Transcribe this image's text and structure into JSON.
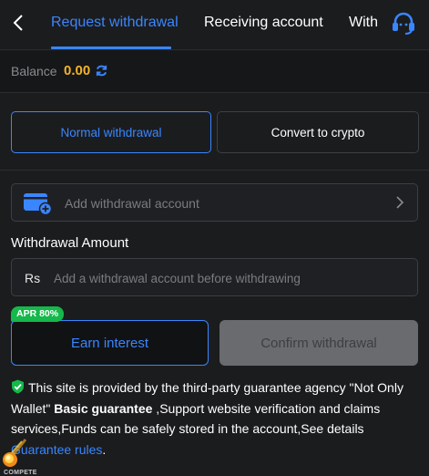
{
  "header": {
    "tabs": [
      {
        "label": "Request withdrawal",
        "active": true
      },
      {
        "label": "Receiving account",
        "active": false
      },
      {
        "label": "With",
        "active": false
      }
    ]
  },
  "balance": {
    "label": "Balance",
    "value": "0.00"
  },
  "withdraw_modes": {
    "normal": "Normal withdrawal",
    "crypto": "Convert to crypto"
  },
  "account": {
    "placeholder": "Add withdrawal account"
  },
  "amount": {
    "label": "Withdrawal Amount",
    "currency": "Rs",
    "placeholder": "Add a withdrawal account before withdrawing"
  },
  "actions": {
    "apr_badge": "APR 80%",
    "earn": "Earn interest",
    "confirm": "Confirm withdrawal"
  },
  "notice": {
    "part1": "This site is provided by the third-party guarantee agency \"Not Only Wallet\" ",
    "bold": "Basic guarantee",
    "part2": " ,Support website verification and claims services,Funds can be safely stored in the account,See details ",
    "link": "Guarantee rules",
    "end": "."
  },
  "floating": {
    "label": "COMPETE"
  },
  "colors": {
    "accent": "#3a86ff",
    "balance": "#f2b42a",
    "badge": "#15b84a",
    "background": "#1b1c1e"
  },
  "icons": [
    "back-arrow-icon",
    "headset-icon",
    "refresh-icon",
    "wallet-add-icon",
    "chevron-right-icon",
    "shield-check-icon",
    "comet-icon"
  ]
}
